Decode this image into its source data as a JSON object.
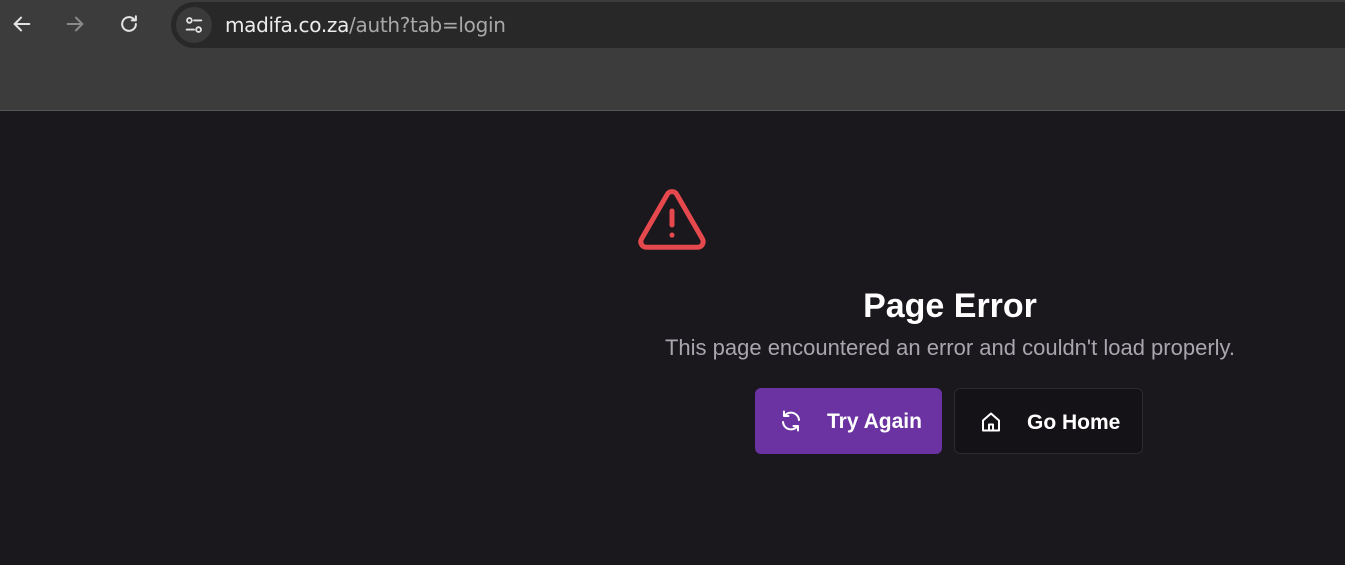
{
  "browser": {
    "url_host": "madifa.co.za",
    "url_path": "/auth?tab=login",
    "icons": {
      "back": "arrow-left-icon",
      "forward": "arrow-right-icon",
      "reload": "reload-icon",
      "site_info": "tune-icon"
    }
  },
  "error": {
    "icon": "warning-triangle-icon",
    "icon_color": "#e5484d",
    "title": "Page Error",
    "message": "This page encountered an error and couldn't load properly."
  },
  "actions": {
    "try_again": {
      "label": "Try Again",
      "icon": "refresh-icon",
      "color": "#6a33a1"
    },
    "go_home": {
      "label": "Go Home",
      "icon": "home-icon"
    }
  }
}
